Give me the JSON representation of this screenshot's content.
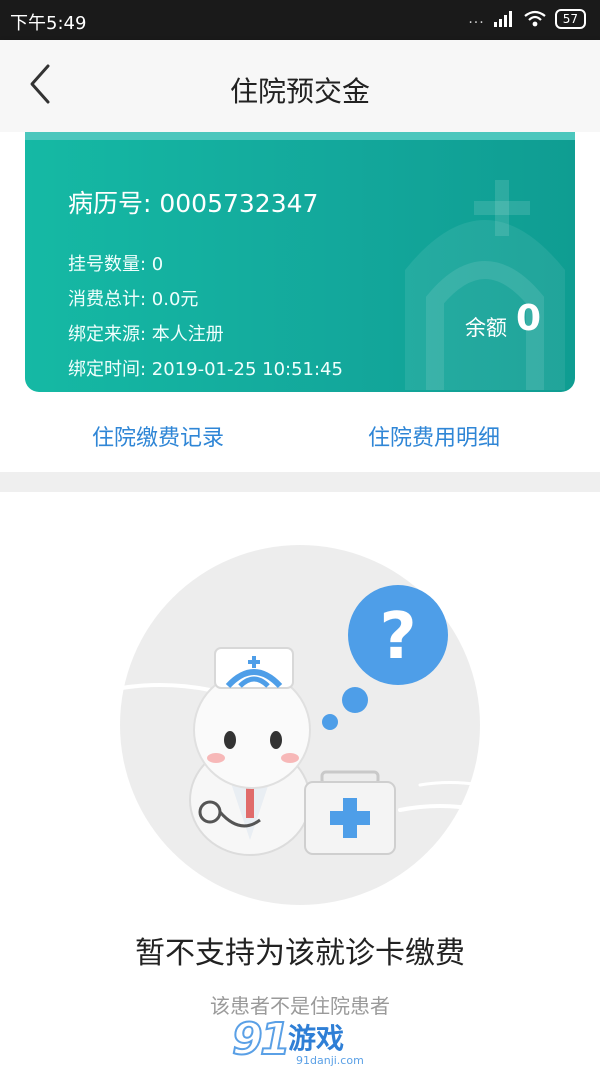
{
  "status": {
    "time": "下午5:49",
    "dots": "...",
    "battery": "57"
  },
  "nav": {
    "title": "住院预交金"
  },
  "card": {
    "record_no": "病历号: 0005732347",
    "lines": [
      "挂号数量: 0",
      "消费总计: 0.0元",
      "绑定来源: 本人注册",
      "绑定时间: 2019-01-25 10:51:45"
    ],
    "balance_label": "余额",
    "balance_value": "0"
  },
  "links": {
    "left": "住院缴费记录",
    "right": "住院费用明细"
  },
  "empty": {
    "title": "暂不支持为该就诊卡缴费",
    "subtitle": "该患者不是住院患者"
  },
  "watermark": {
    "brand": "游戏",
    "site": "91danji.com"
  },
  "colors": {
    "accent_teal": "#13a79b",
    "link_blue": "#2f86d6",
    "status_bar": "#1a1a1a"
  }
}
